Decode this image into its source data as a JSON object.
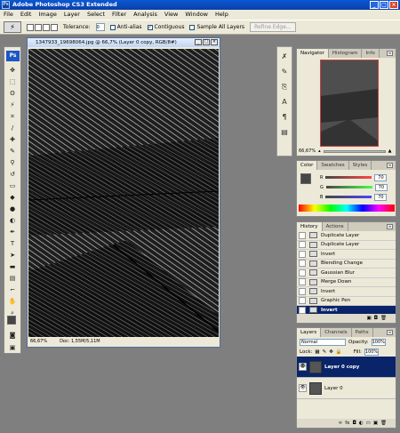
{
  "app": {
    "title": "Adobe Photoshop CS3 Extended",
    "logo": "Ps"
  },
  "menu": [
    "File",
    "Edit",
    "Image",
    "Layer",
    "Select",
    "Filter",
    "Analysis",
    "View",
    "Window",
    "Help"
  ],
  "options": {
    "tolerance_label": "Tolerance:",
    "tolerance_value": "0",
    "antialias": "Anti-alias",
    "contiguous": "Contiguous",
    "sample_all": "Sample All Layers",
    "refine": "Refine Edge..."
  },
  "document": {
    "title": "1347933_19698064.jpg @ 66,7% (Layer 0 copy, RGB/8#)",
    "zoom": "66,67%",
    "doc_size": "Doc: 1,55M/5,11M"
  },
  "navigator": {
    "tabs": [
      "Navigator",
      "Histogram",
      "Info"
    ],
    "zoom": "66,67%"
  },
  "color": {
    "tabs": [
      "Color",
      "Swatches",
      "Styles"
    ],
    "channels": [
      {
        "label": "R",
        "value": "70"
      },
      {
        "label": "G",
        "value": "70"
      },
      {
        "label": "B",
        "value": "70"
      }
    ]
  },
  "history": {
    "tabs": [
      "History",
      "Actions"
    ],
    "items": [
      "Duplicate Layer",
      "Duplicate Layer",
      "Invert",
      "Blending Change",
      "Gaussian Blur",
      "Merge Down",
      "Invert",
      "Graphic Pen",
      "Invert"
    ],
    "active_index": 8
  },
  "layers": {
    "tabs": [
      "Layers",
      "Channels",
      "Paths"
    ],
    "blend_mode": "Normal",
    "opacity_label": "Opacity:",
    "opacity": "100%",
    "lock_label": "Lock:",
    "fill_label": "Fill:",
    "fill": "100%",
    "items": [
      {
        "name": "Layer 0 copy",
        "active": true
      },
      {
        "name": "Layer 0",
        "active": false
      }
    ]
  },
  "colors": {
    "title_blue": "#0a3fa8",
    "selection": "#0a246a"
  }
}
